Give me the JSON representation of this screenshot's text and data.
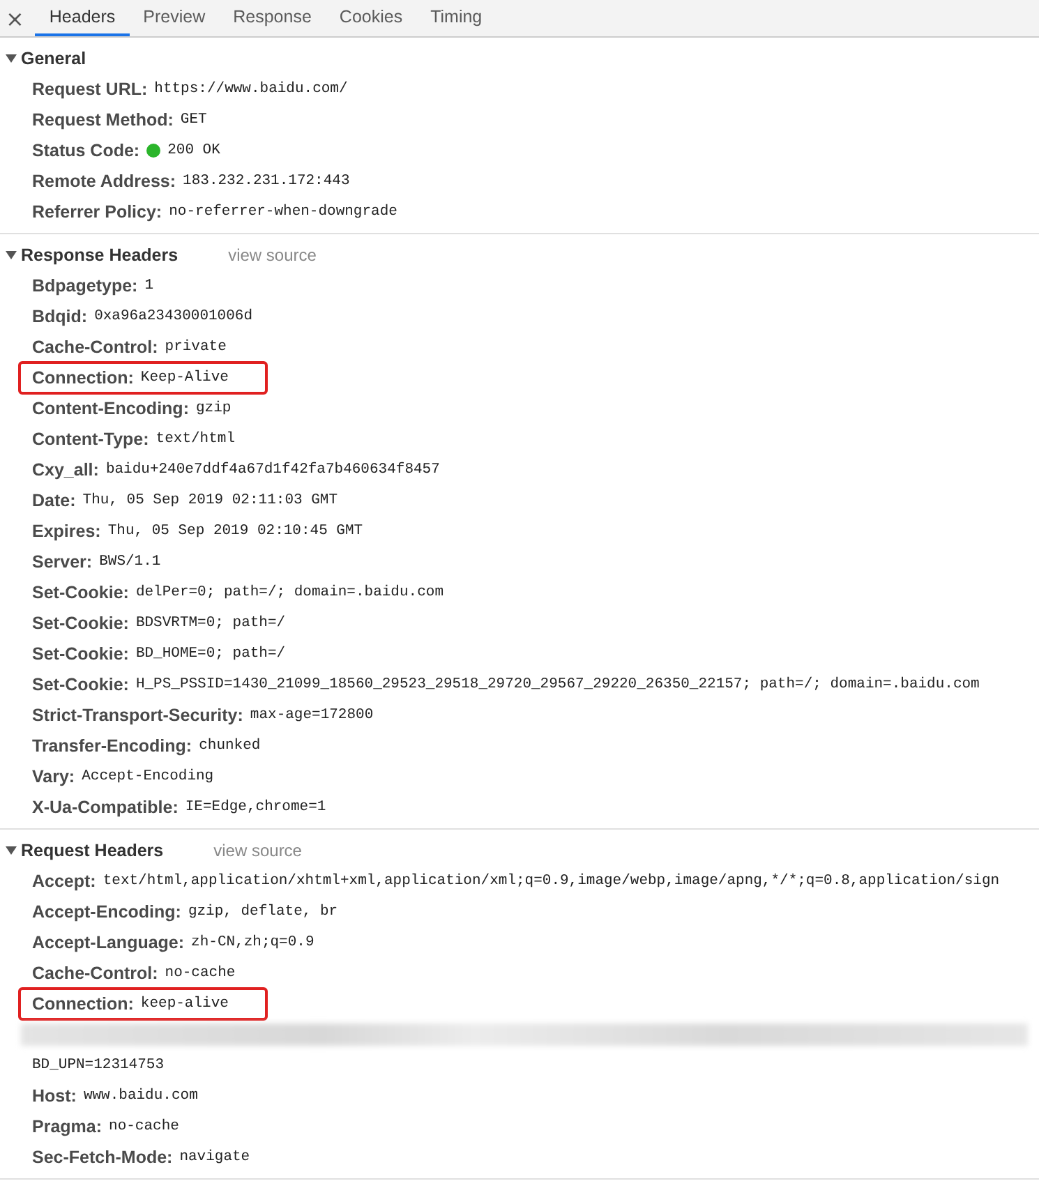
{
  "close_label": "×",
  "tabs": [
    {
      "label": "Headers",
      "selected": true
    },
    {
      "label": "Preview",
      "selected": false
    },
    {
      "label": "Response",
      "selected": false
    },
    {
      "label": "Cookies",
      "selected": false
    },
    {
      "label": "Timing",
      "selected": false
    }
  ],
  "sections": [
    {
      "title": "General",
      "expanded": true,
      "rows": [
        {
          "kind": "header",
          "name": "Request URL:",
          "value": "https://www.baidu.com/",
          "highlighted": false
        },
        {
          "kind": "header",
          "name": "Request Method:",
          "value": "GET",
          "highlighted": false
        },
        {
          "kind": "header",
          "name": "Status Code:",
          "value": "200 OK",
          "highlighted": false,
          "color": "#2bb52b"
        },
        {
          "kind": "header",
          "name": "Remote Address:",
          "value": "183.232.231.172:443",
          "highlighted": false
        },
        {
          "kind": "header",
          "name": "Referrer Policy:",
          "value": "no-referrer-when-downgrade",
          "highlighted": false
        }
      ]
    },
    {
      "title": "Response Headers",
      "expanded": true,
      "view_source": "view source",
      "rows": [
        {
          "kind": "header",
          "name": "Bdpagetype:",
          "value": "1",
          "highlighted": false
        },
        {
          "kind": "header",
          "name": "Bdqid:",
          "value": "0xa96a23430001006d",
          "highlighted": false
        },
        {
          "kind": "header",
          "name": "Cache-Control:",
          "value": "private",
          "highlighted": false
        },
        {
          "kind": "header",
          "name": "Connection:",
          "value": "Keep-Alive",
          "highlighted": true
        },
        {
          "kind": "header",
          "name": "Content-Encoding:",
          "value": "gzip",
          "highlighted": false
        },
        {
          "kind": "header",
          "name": "Content-Type:",
          "value": "text/html",
          "highlighted": false
        },
        {
          "kind": "header",
          "name": "Cxy_all:",
          "value": "baidu+240e7ddf4a67d1f42fa7b460634f8457",
          "highlighted": false
        },
        {
          "kind": "header",
          "name": "Date:",
          "value": "Thu, 05 Sep 2019 02:11:03 GMT",
          "highlighted": false
        },
        {
          "kind": "header",
          "name": "Expires:",
          "value": "Thu, 05 Sep 2019 02:10:45 GMT",
          "highlighted": false
        },
        {
          "kind": "header",
          "name": "Server:",
          "value": "BWS/1.1",
          "highlighted": false
        },
        {
          "kind": "header",
          "name": "Set-Cookie:",
          "value": "delPer=0; path=/; domain=.baidu.com",
          "highlighted": false
        },
        {
          "kind": "header",
          "name": "Set-Cookie:",
          "value": "BDSVRTM=0; path=/",
          "highlighted": false
        },
        {
          "kind": "header",
          "name": "Set-Cookie:",
          "value": "BD_HOME=0; path=/",
          "highlighted": false
        },
        {
          "kind": "header",
          "name": "Set-Cookie:",
          "value": "H_PS_PSSID=1430_21099_18560_29523_29518_29720_29567_29220_26350_22157; path=/; domain=.baidu.com",
          "highlighted": false
        },
        {
          "kind": "header",
          "name": "Strict-Transport-Security:",
          "value": "max-age=172800",
          "highlighted": false
        },
        {
          "kind": "header",
          "name": "Transfer-Encoding:",
          "value": "chunked",
          "highlighted": false
        },
        {
          "kind": "header",
          "name": "Vary:",
          "value": "Accept-Encoding",
          "highlighted": false
        },
        {
          "kind": "header",
          "name": "X-Ua-Compatible:",
          "value": "IE=Edge,chrome=1",
          "highlighted": false
        }
      ]
    },
    {
      "title": "Request Headers",
      "expanded": true,
      "view_source": "view source",
      "rows": [
        {
          "kind": "header",
          "name": "Accept:",
          "value": "text/html,application/xhtml+xml,application/xml;q=0.9,image/webp,image/apng,*/*;q=0.8,application/sign",
          "highlighted": false
        },
        {
          "kind": "header",
          "name": "Accept-Encoding:",
          "value": "gzip, deflate, br",
          "highlighted": false
        },
        {
          "kind": "header",
          "name": "Accept-Language:",
          "value": "zh-CN,zh;q=0.9",
          "highlighted": false
        },
        {
          "kind": "header",
          "name": "Cache-Control:",
          "value": "no-cache",
          "highlighted": false
        },
        {
          "kind": "header",
          "name": "Connection:",
          "value": "keep-alive",
          "highlighted": true
        },
        {
          "kind": "redacted"
        },
        {
          "kind": "raw",
          "value": "BD_UPN=12314753"
        },
        {
          "kind": "header",
          "name": "Host:",
          "value": "www.baidu.com",
          "highlighted": false
        },
        {
          "kind": "header",
          "name": "Pragma:",
          "value": "no-cache",
          "highlighted": false
        },
        {
          "kind": "header",
          "name": "Sec-Fetch-Mode:",
          "value": "navigate",
          "highlighted": false
        }
      ]
    }
  ]
}
